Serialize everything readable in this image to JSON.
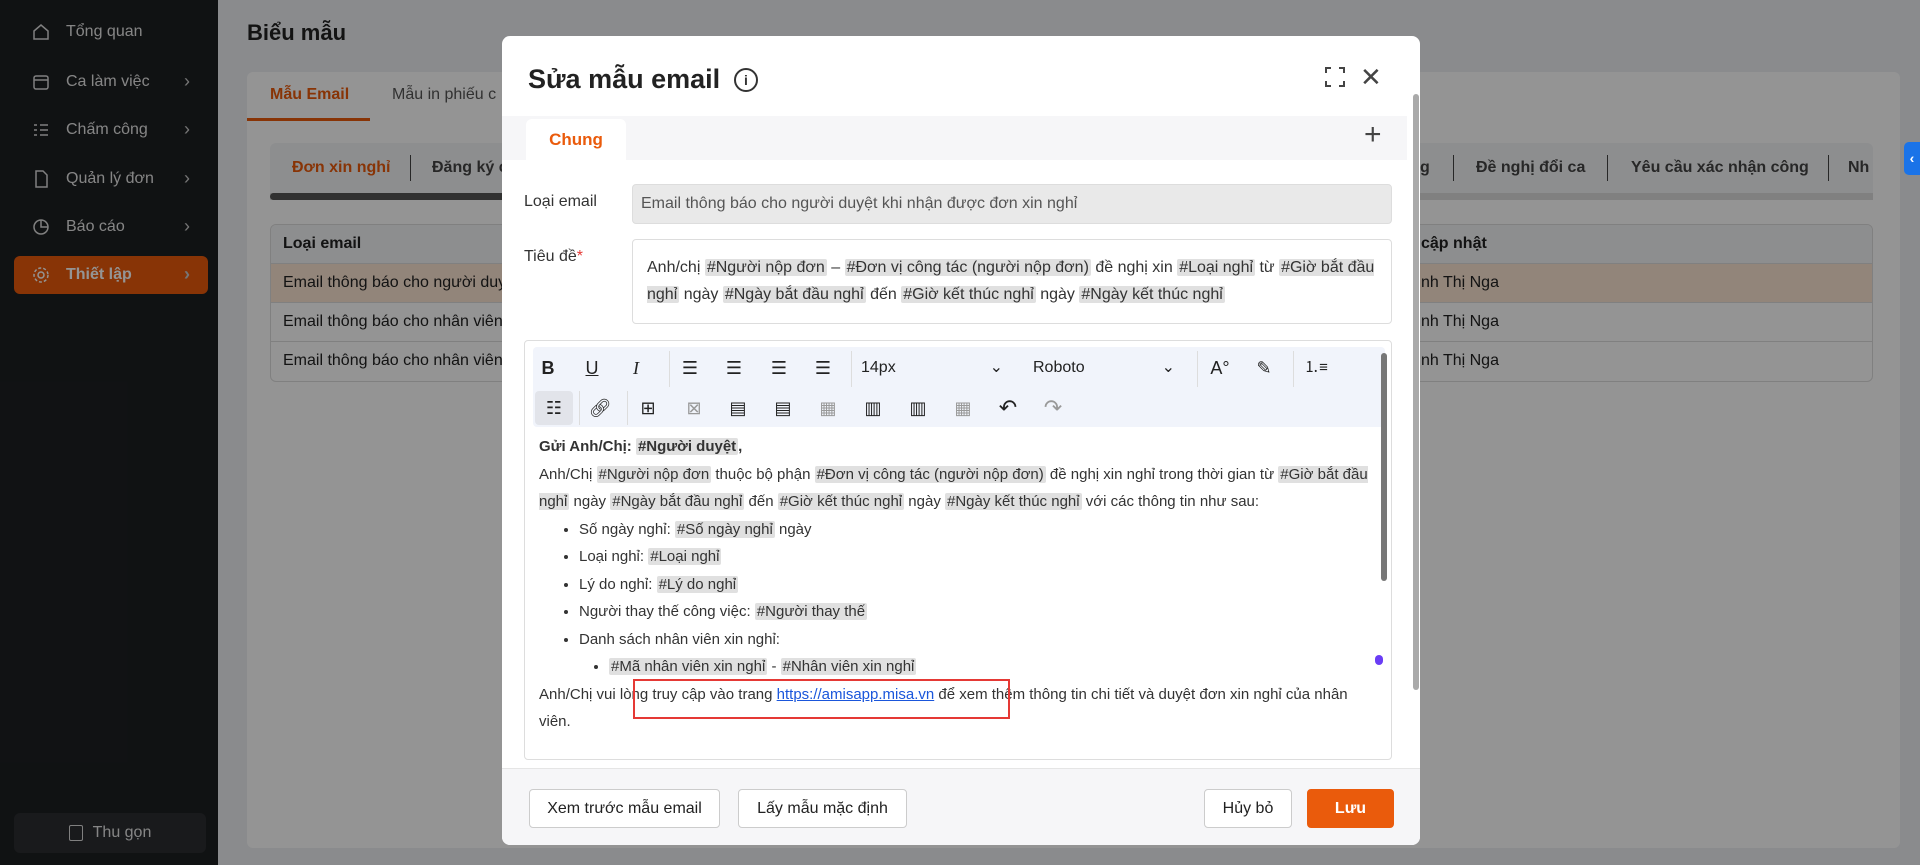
{
  "sidebar": {
    "items": [
      {
        "label": "Tổng quan",
        "icon": "home-icon"
      },
      {
        "label": "Ca làm việc",
        "icon": "calendar-icon"
      },
      {
        "label": "Chấm công",
        "icon": "checklist-icon"
      },
      {
        "label": "Quản lý đơn",
        "icon": "document-icon"
      },
      {
        "label": "Báo cáo",
        "icon": "pie-chart-icon"
      },
      {
        "label": "Thiết lập",
        "icon": "gear-icon"
      }
    ],
    "collapse_label": "Thu gọn"
  },
  "page": {
    "title": "Biểu mẫu",
    "tabs": [
      "Mẫu Email",
      "Mẫu in phiếu c"
    ],
    "subtabs": {
      "first": "Đơn xin nghỉ",
      "second": "Đăng ký c",
      "partial": "g",
      "doi_ca": "Đề nghị đổi ca",
      "xac_nhan": "Yêu cầu xác nhận công",
      "last": "Nh"
    },
    "table": {
      "headers": [
        "Loại email",
        "cập nhật"
      ],
      "rows": [
        [
          "Email thông báo cho người duyệt khi nhận được đơn xin nghỉ",
          "nh Thị Nga"
        ],
        [
          "Email thông báo cho nhân viên",
          "nh Thị Nga"
        ],
        [
          "Email thông báo cho nhân viên",
          "nh Thị Nga"
        ]
      ]
    }
  },
  "modal": {
    "title": "Sửa mẫu email",
    "tab": "Chung",
    "loai_label": "Loại email",
    "loai_value": "Email thông báo cho người duyệt khi nhận được đơn xin nghỉ",
    "tieude_label": "Tiêu đề",
    "required_mark": "*",
    "tieude_segments": [
      {
        "t": "Anh/chị "
      },
      {
        "t": "#Người nộp đơn",
        "tag": true
      },
      {
        "t": " – "
      },
      {
        "t": "#Đơn vị công tác (người nộp đơn)",
        "tag": true
      },
      {
        "t": " đề nghị xin "
      },
      {
        "t": "#Loại nghỉ",
        "tag": true
      },
      {
        "t": " từ "
      },
      {
        "t": "#Giờ bắt đầu nghỉ",
        "tag": true
      },
      {
        "t": " ngày "
      },
      {
        "t": "#Ngày bắt đầu nghỉ",
        "tag": true
      },
      {
        "t": " đến "
      },
      {
        "t": "#Giờ kết thúc nghỉ",
        "tag": true
      },
      {
        "t": " ngày "
      },
      {
        "t": "#Ngày kết thúc nghỉ",
        "tag": true
      }
    ],
    "toolbar": {
      "font_size": "14px",
      "font_family": "Roboto"
    },
    "content": {
      "greeting": [
        {
          "t": "Gửi Anh/Chị: ",
          "b": true
        },
        {
          "t": "#Người duyệt",
          "tag": true,
          "b": true
        },
        {
          "t": ",",
          "b": true
        }
      ],
      "intro": [
        {
          "t": "Anh/Chị "
        },
        {
          "t": "#Người nộp đơn",
          "tag": true
        },
        {
          "t": " thuộc bộ phận "
        },
        {
          "t": "#Đơn vị công tác (người nộp đơn)",
          "tag": true
        },
        {
          "t": " đề nghị xin nghỉ trong thời gian từ "
        },
        {
          "t": "#Giờ bắt đầu nghỉ",
          "tag": true
        },
        {
          "t": " ngày "
        },
        {
          "t": "#Ngày bắt đầu nghỉ",
          "tag": true
        },
        {
          "t": " đến "
        },
        {
          "t": "#Giờ kết thúc nghỉ",
          "tag": true
        },
        {
          "t": " ngày "
        },
        {
          "t": "#Ngày kết thúc nghỉ",
          "tag": true
        },
        {
          "t": " với các thông tin như sau:"
        }
      ],
      "bullets": [
        [
          {
            "t": "Số ngày nghỉ: "
          },
          {
            "t": "#Số ngày nghỉ",
            "tag": true
          },
          {
            "t": " ngày"
          }
        ],
        [
          {
            "t": "Loại nghỉ: "
          },
          {
            "t": "#Loại nghỉ",
            "tag": true
          }
        ],
        [
          {
            "t": "Lý do nghỉ: "
          },
          {
            "t": "#Lý do nghỉ",
            "tag": true
          }
        ],
        [
          {
            "t": "Người thay thế công việc: "
          },
          {
            "t": "#Người thay thế",
            "tag": true
          }
        ],
        [
          {
            "t": "Danh sách nhân viên xin nghỉ:"
          }
        ]
      ],
      "sub_bullet": [
        {
          "t": "#Mã nhân viên xin nghỉ",
          "tag": true
        },
        {
          "t": " - "
        },
        {
          "t": "#Nhân viên xin nghỉ",
          "tag": true
        }
      ],
      "outro_before": "Anh/Chị vui lòng truy cập vào trang ",
      "link": "https://amisapp.misa.vn",
      "outro_after": " để xem thêm thông tin chi tiết và duyệt đơn xin nghỉ của nhân viên."
    },
    "footer": {
      "preview": "Xem trước mẫu email",
      "default": "Lấy mẫu mặc định",
      "cancel": "Hủy bỏ",
      "save": "Lưu"
    }
  },
  "colors": {
    "accent": "#ea5b0c",
    "highlight_box": "#e53935"
  }
}
